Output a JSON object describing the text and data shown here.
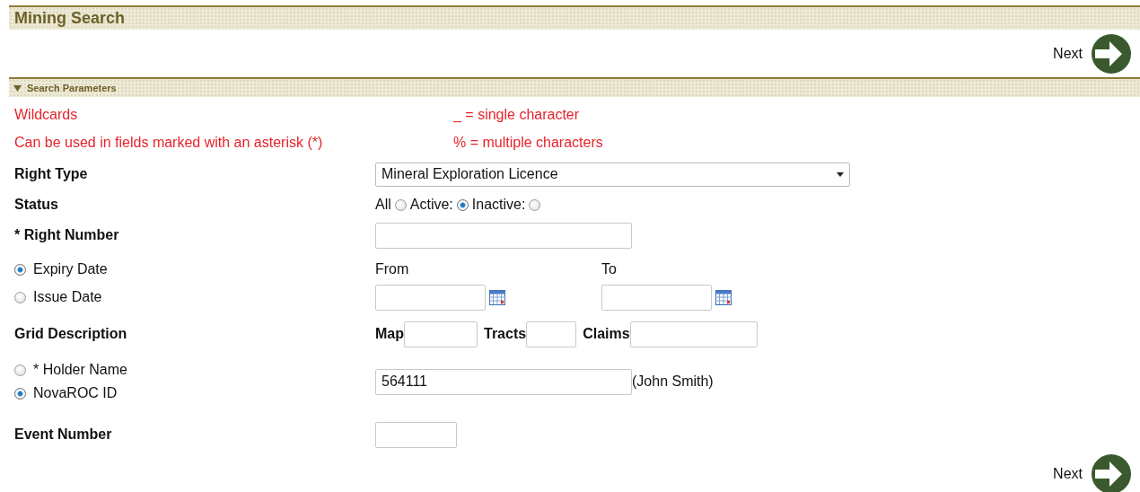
{
  "title": "Mining Search",
  "next_buttons": [
    {
      "label": "Next"
    },
    {
      "label": "Next"
    }
  ],
  "section": {
    "label": "Search Parameters",
    "expanded": true
  },
  "wildcards": {
    "title": "Wildcards",
    "note": "Can be used in fields marked with an asterisk (*)",
    "single": "_ = single character",
    "multiple": "% = multiple characters"
  },
  "right_type": {
    "label": "Right Type",
    "value": "Mineral Exploration Licence"
  },
  "status": {
    "label": "Status",
    "options": [
      {
        "label": "All",
        "selected": false
      },
      {
        "label": "Active:",
        "selected": true
      },
      {
        "label": "Inactive:",
        "selected": false
      }
    ]
  },
  "right_number": {
    "label": "* Right Number"
  },
  "date_type": [
    {
      "label": "Expiry Date",
      "selected": true
    },
    {
      "label": "Issue Date",
      "selected": false
    }
  ],
  "date_range": [
    {
      "label": "From"
    },
    {
      "label": "To"
    }
  ],
  "grid_description": {
    "label": "Grid Description",
    "fields": [
      "Map",
      "Tracts",
      "Claims"
    ]
  },
  "holder": {
    "options": [
      {
        "label": "* Holder Name",
        "selected": false
      },
      {
        "label": "NovaROC ID",
        "selected": true
      }
    ],
    "value": "564111",
    "resolved_name": "(John Smith)"
  },
  "event_number": {
    "label": "Event Number"
  }
}
